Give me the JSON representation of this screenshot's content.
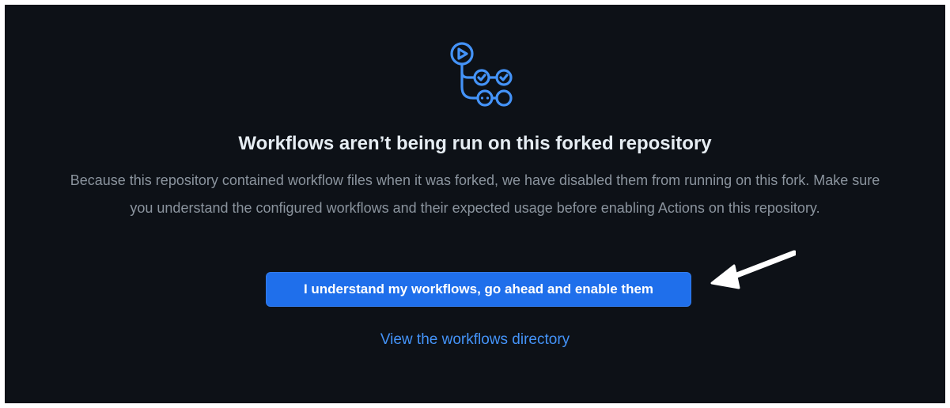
{
  "empty_state": {
    "title": "Workflows aren’t being run on this forked repository",
    "description": "Because this repository contained workflow files when it was forked, we have disabled them from running on this fork. Make sure you understand the configured workflows and their expected usage before enabling Actions on this repository.",
    "enable_button_label": "I understand my workflows, go ahead and enable them",
    "view_workflows_link": "View the workflows directory"
  },
  "icons": {
    "logo": "github-actions-icon",
    "annotation": "white-arrow-annotation"
  },
  "colors": {
    "background": "#0d1117",
    "title": "#e6edf3",
    "description": "#8b949e",
    "button": "#1f6feb",
    "link": "#4493f8",
    "icon": "#4493f8"
  }
}
